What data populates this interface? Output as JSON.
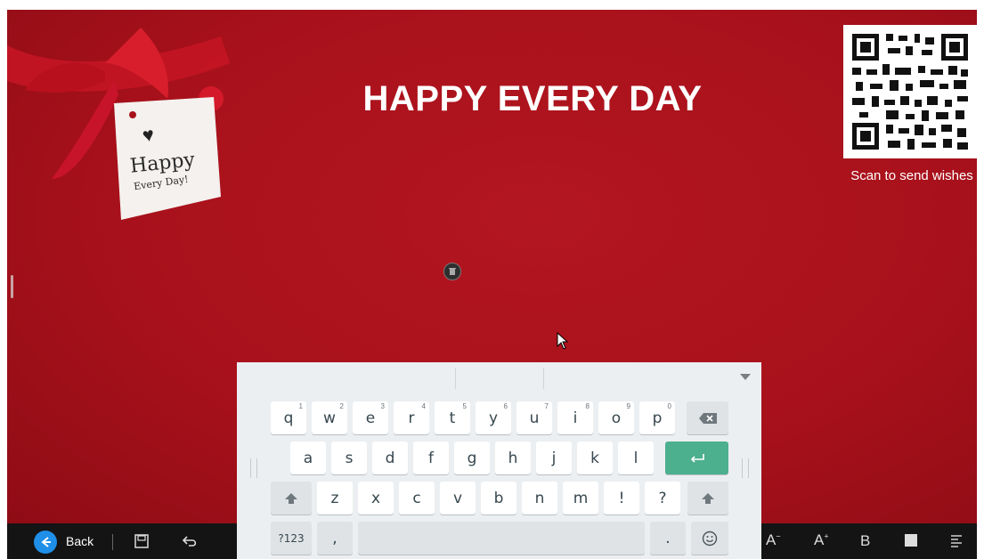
{
  "canvas": {
    "title": "HAPPY EVERY DAY",
    "qr_caption": "Scan to send wishes",
    "gift_tag": {
      "line1": "Happy",
      "line2": "Every Day!"
    },
    "colors": {
      "background": "#a8111b",
      "ribbon": "#c8102e",
      "text": "#ffffff"
    }
  },
  "toolbar": {
    "back_label": "Back",
    "icons": [
      "back-arrow-icon",
      "save-icon",
      "undo-icon",
      "font-decrease-icon",
      "font-increase-icon",
      "bold-icon",
      "text-box-icon",
      "align-icon"
    ],
    "font_decrease_label": "A",
    "font_increase_label": "A",
    "bold_label": "B"
  },
  "keyboard": {
    "row1": [
      {
        "k": "q",
        "h": "1"
      },
      {
        "k": "w",
        "h": "2"
      },
      {
        "k": "e",
        "h": "3"
      },
      {
        "k": "r",
        "h": "4"
      },
      {
        "k": "t",
        "h": "5"
      },
      {
        "k": "y",
        "h": "6"
      },
      {
        "k": "u",
        "h": "7"
      },
      {
        "k": "i",
        "h": "8"
      },
      {
        "k": "o",
        "h": "9"
      },
      {
        "k": "p",
        "h": "0"
      }
    ],
    "row2": [
      "a",
      "s",
      "d",
      "f",
      "g",
      "h",
      "j",
      "k",
      "l"
    ],
    "row3": [
      "z",
      "x",
      "c",
      "v",
      "b",
      "n",
      "m",
      "!",
      "?"
    ],
    "symbols_label": "?123",
    "comma_label": ",",
    "period_label": ".",
    "accent_color": "#4caf8e"
  }
}
